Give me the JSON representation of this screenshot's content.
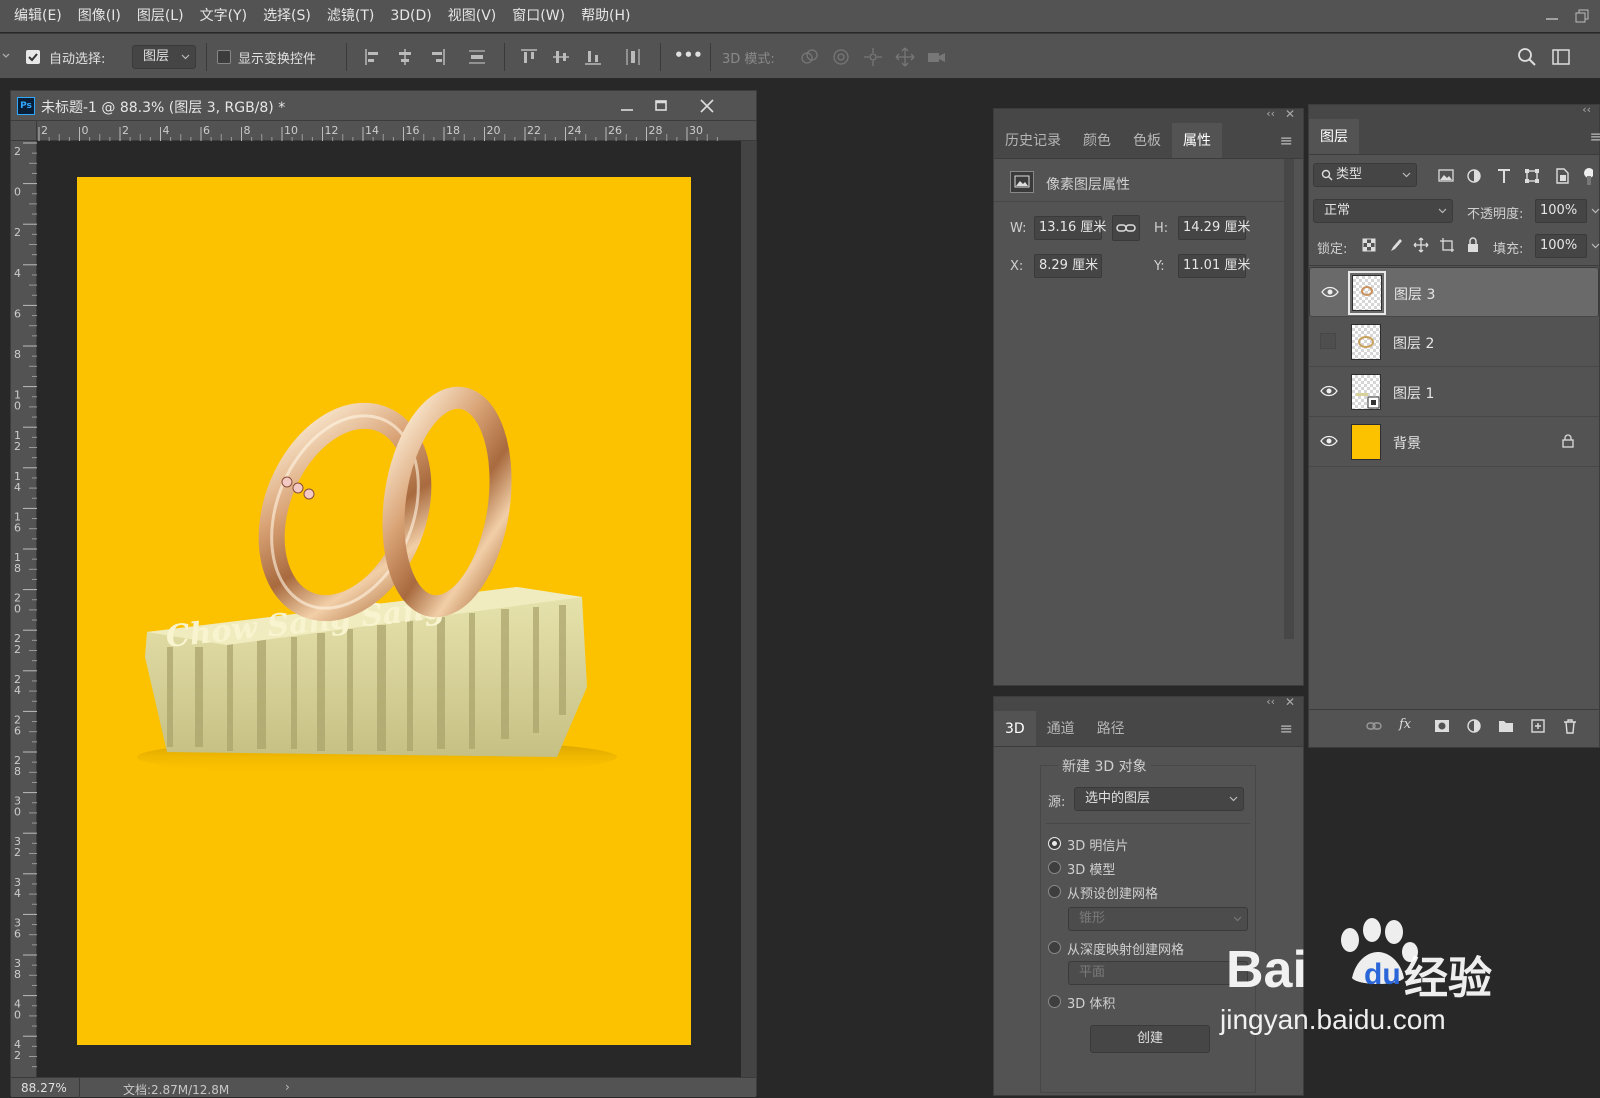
{
  "menubar": {
    "items": [
      "编辑(E)",
      "图像(I)",
      "图层(L)",
      "文字(Y)",
      "选择(S)",
      "滤镜(T)",
      "3D(D)",
      "视图(V)",
      "窗口(W)",
      "帮助(H)"
    ]
  },
  "options": {
    "auto_select_label": "自动选择:",
    "auto_select_checked": true,
    "auto_select_target": "图层",
    "show_transform_label": "显示变换控件",
    "show_transform_checked": false,
    "more_label": "•••",
    "mode_3d_label": "3D 模式:"
  },
  "document": {
    "title": "未标题-1 @ 88.3% (图层 3, RGB/8) *",
    "ps_badge": "Ps",
    "ruler_h_labels": [
      "2",
      "0",
      "2",
      "4",
      "6",
      "8",
      "10",
      "12",
      "14",
      "16",
      "18",
      "20",
      "22",
      "24",
      "26",
      "28",
      "30"
    ],
    "ruler_v_labels": [
      "2",
      "0",
      "2",
      "4",
      "6",
      "8",
      "10",
      "12",
      "14",
      "16",
      "18",
      "20",
      "22",
      "24",
      "26",
      "28",
      "30",
      "32",
      "34",
      "36",
      "38",
      "40",
      "42"
    ],
    "zoom": "88.27%",
    "doc_info": "文档:2.87M/12.8M",
    "canvas_color": "#fcc200",
    "artwork_text": "Chow Sang Sang"
  },
  "props_panel": {
    "tabs": [
      "历史记录",
      "颜色",
      "色板",
      "属性"
    ],
    "active_tab": "属性",
    "header": "像素图层属性",
    "w_label": "W:",
    "w_value": "13.16 厘米",
    "h_label": "H:",
    "h_value": "14.29 厘米",
    "x_label": "X:",
    "x_value": "8.29 厘米",
    "y_label": "Y:",
    "y_value": "11.01 厘米"
  },
  "panel_3d": {
    "tabs": [
      "3D",
      "通道",
      "路径"
    ],
    "active_tab": "3D",
    "group_title": "新建 3D 对象",
    "source_label": "源:",
    "source_value": "选中的图层",
    "options": [
      "3D 明信片",
      "3D 模型",
      "从预设创建网格",
      "从深度映射创建网格",
      "3D 体积"
    ],
    "selected_option": "3D 明信片",
    "preset_mesh_value": "锥形",
    "depth_map_value": "平面",
    "create_button": "创建"
  },
  "layers_panel": {
    "tab": "图层",
    "filter_label": "类型",
    "blend_mode": "正常",
    "opacity_label": "不透明度:",
    "opacity_value": "100%",
    "lock_label": "锁定:",
    "fill_label": "填充:",
    "fill_value": "100%",
    "layers": [
      {
        "name": "图层 3",
        "visible": true,
        "selected": true
      },
      {
        "name": "图层 2",
        "visible": false,
        "selected": false
      },
      {
        "name": "图层 1",
        "visible": true,
        "selected": false
      },
      {
        "name": "背景",
        "visible": true,
        "selected": false,
        "locked": true
      }
    ]
  },
  "watermark": {
    "brand": "Bai",
    "brand_suffix": "du",
    "cn": "经验",
    "url": "jingyan.baidu.com"
  }
}
